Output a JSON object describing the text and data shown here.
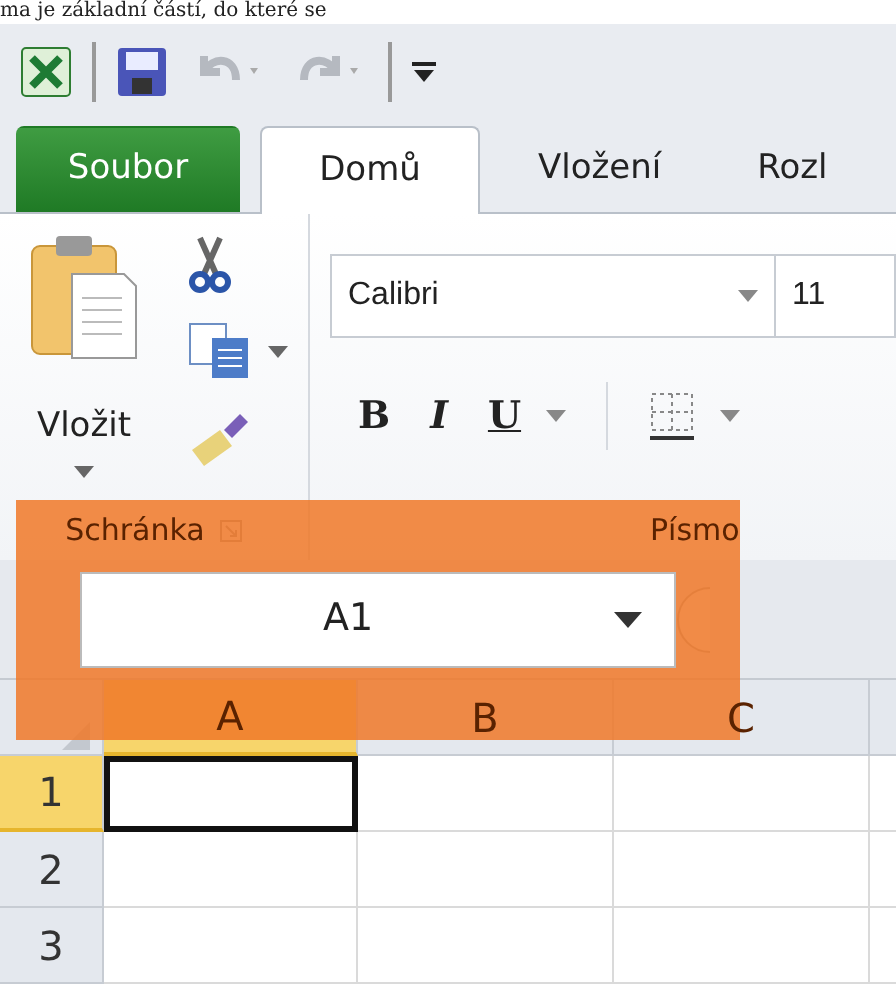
{
  "document_text": "ma je základní částí, do které se",
  "tabs": [
    {
      "label": "Soubor",
      "kind": "file",
      "selected": false
    },
    {
      "label": "Domů",
      "kind": "tab",
      "selected": true
    },
    {
      "label": "Vložení",
      "kind": "tab",
      "selected": false
    },
    {
      "label": "Rozl",
      "kind": "tab",
      "selected": false
    }
  ],
  "clipboard": {
    "paste_label": "Vložit",
    "group_label": "Schránka"
  },
  "font": {
    "name": "Calibri",
    "size": "11",
    "bold": "B",
    "italic": "I",
    "underline": "U",
    "group_label": "Písmo"
  },
  "name_box": {
    "value": "A1"
  },
  "grid": {
    "columns": [
      {
        "label": "A",
        "selected": true
      },
      {
        "label": "B",
        "selected": false
      },
      {
        "label": "C",
        "selected": false
      }
    ],
    "rows": [
      {
        "label": "1",
        "selected": true
      },
      {
        "label": "2",
        "selected": false
      },
      {
        "label": "3",
        "selected": false
      }
    ]
  },
  "highlight_visible": true
}
